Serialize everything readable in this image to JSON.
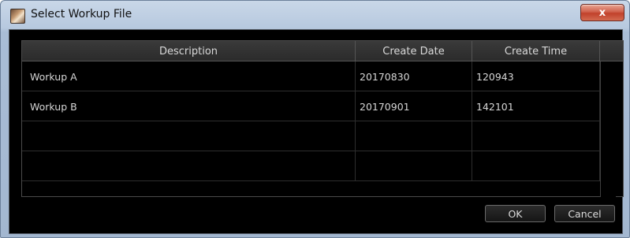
{
  "window": {
    "title": "Select Workup File",
    "close_glyph": "x",
    "icons": {
      "app": "app-photo-icon",
      "close": "close-icon"
    }
  },
  "table": {
    "columns": [
      "Description",
      "Create Date",
      "Create Time"
    ],
    "rows": [
      {
        "description": "Workup A",
        "create_date": "20170830",
        "create_time": "120943"
      },
      {
        "description": "Workup B",
        "create_date": "20170901",
        "create_time": "142101"
      },
      {
        "description": "",
        "create_date": "",
        "create_time": ""
      },
      {
        "description": "",
        "create_date": "",
        "create_time": ""
      }
    ]
  },
  "buttons": {
    "ok": "OK",
    "cancel": "Cancel"
  },
  "colors": {
    "client_background": "#000000",
    "close_button": "#c1412b",
    "title_bar": "#b7c9df"
  }
}
